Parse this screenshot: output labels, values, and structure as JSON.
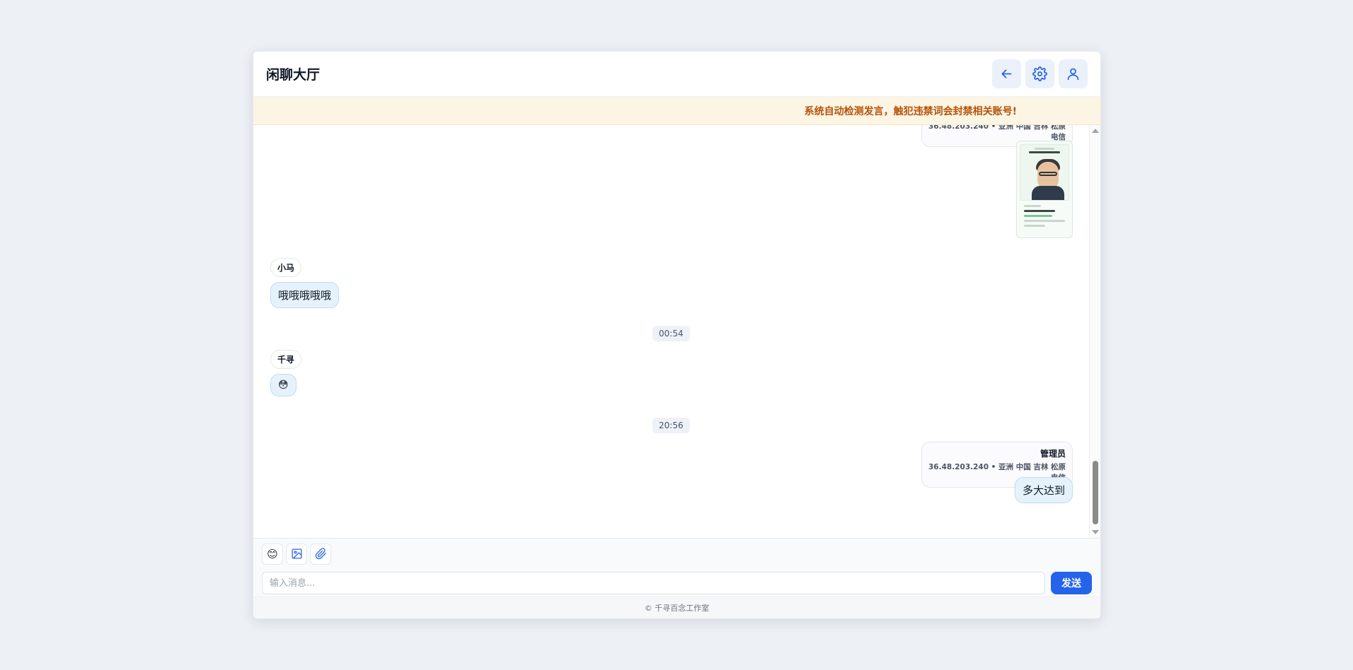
{
  "header": {
    "title": "闲聊大厅"
  },
  "notice": "系统自动检测发言，触犯违禁词会封禁相关账号!",
  "messages": {
    "top_meta_ip": "36.48.203.240 • 亚洲 中国 吉林 松原 电信",
    "m1": {
      "user": "小马",
      "text": "哦哦哦哦哦"
    },
    "t1": "00:54",
    "m2": {
      "user": "千寻",
      "emoji": "😳"
    },
    "t2": "20:56",
    "m3": {
      "user": "管理员",
      "ip": "36.48.203.240 • 亚洲 中国 吉林 松原 电信",
      "text": "多大达到"
    }
  },
  "composer": {
    "placeholder": "输入消息...",
    "send_label": "发送"
  },
  "footer": "© 千寻百念工作室",
  "colors": {
    "accent": "#2563eb",
    "notice_text": "#b45309",
    "bubble": "#e6f2fb"
  }
}
